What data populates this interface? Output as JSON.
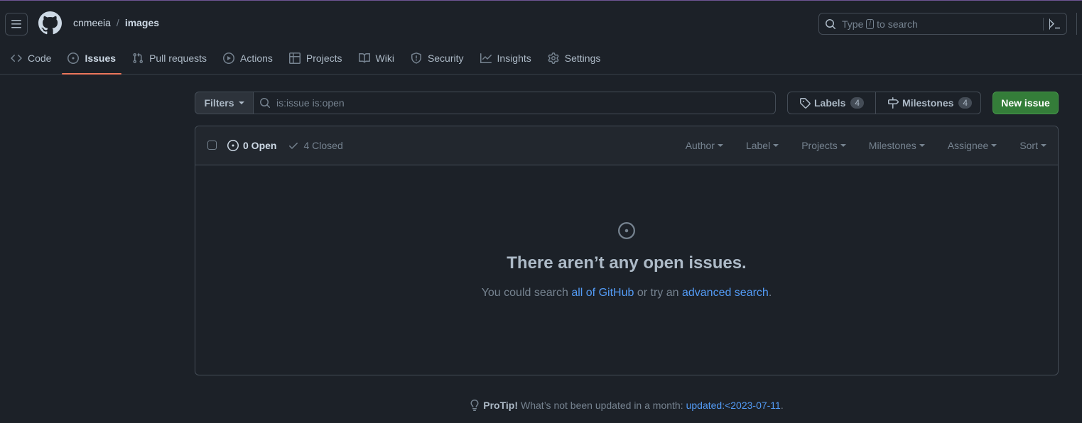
{
  "header": {
    "owner": "cnmeeia",
    "separator": "/",
    "repo": "images",
    "search_prefix": "Type",
    "search_key": "/",
    "search_suffix": "to search"
  },
  "tabs": [
    {
      "label": "Code",
      "icon": "code-icon"
    },
    {
      "label": "Issues",
      "icon": "issue-opened-icon",
      "active": true
    },
    {
      "label": "Pull requests",
      "icon": "git-pull-request-icon"
    },
    {
      "label": "Actions",
      "icon": "play-icon"
    },
    {
      "label": "Projects",
      "icon": "table-icon"
    },
    {
      "label": "Wiki",
      "icon": "book-icon"
    },
    {
      "label": "Security",
      "icon": "shield-icon"
    },
    {
      "label": "Insights",
      "icon": "graph-icon"
    },
    {
      "label": "Settings",
      "icon": "gear-icon"
    }
  ],
  "toolbar": {
    "filters_label": "Filters",
    "filter_query": "is:issue is:open",
    "labels_label": "Labels",
    "labels_count": "4",
    "milestones_label": "Milestones",
    "milestones_count": "4",
    "new_issue_label": "New issue"
  },
  "issues_box": {
    "open_label": "0 Open",
    "closed_label": "4 Closed",
    "filters": [
      "Author",
      "Label",
      "Projects",
      "Milestones",
      "Assignee",
      "Sort"
    ],
    "blank_title": "There aren’t any open issues.",
    "blank_text_1": "You could search",
    "blank_link_1": "all of GitHub",
    "blank_text_2": "or try an",
    "blank_link_2": "advanced search",
    "blank_text_3": "."
  },
  "protip": {
    "bold": "ProTip!",
    "text": "What’s not been updated in a month:",
    "link": "updated:<2023-07-11",
    "end": "."
  },
  "colors": {
    "background": "#1c2128",
    "accent_underline": "#ec775c",
    "new_issue_green": "#347d39",
    "link_blue": "#539bf5"
  }
}
